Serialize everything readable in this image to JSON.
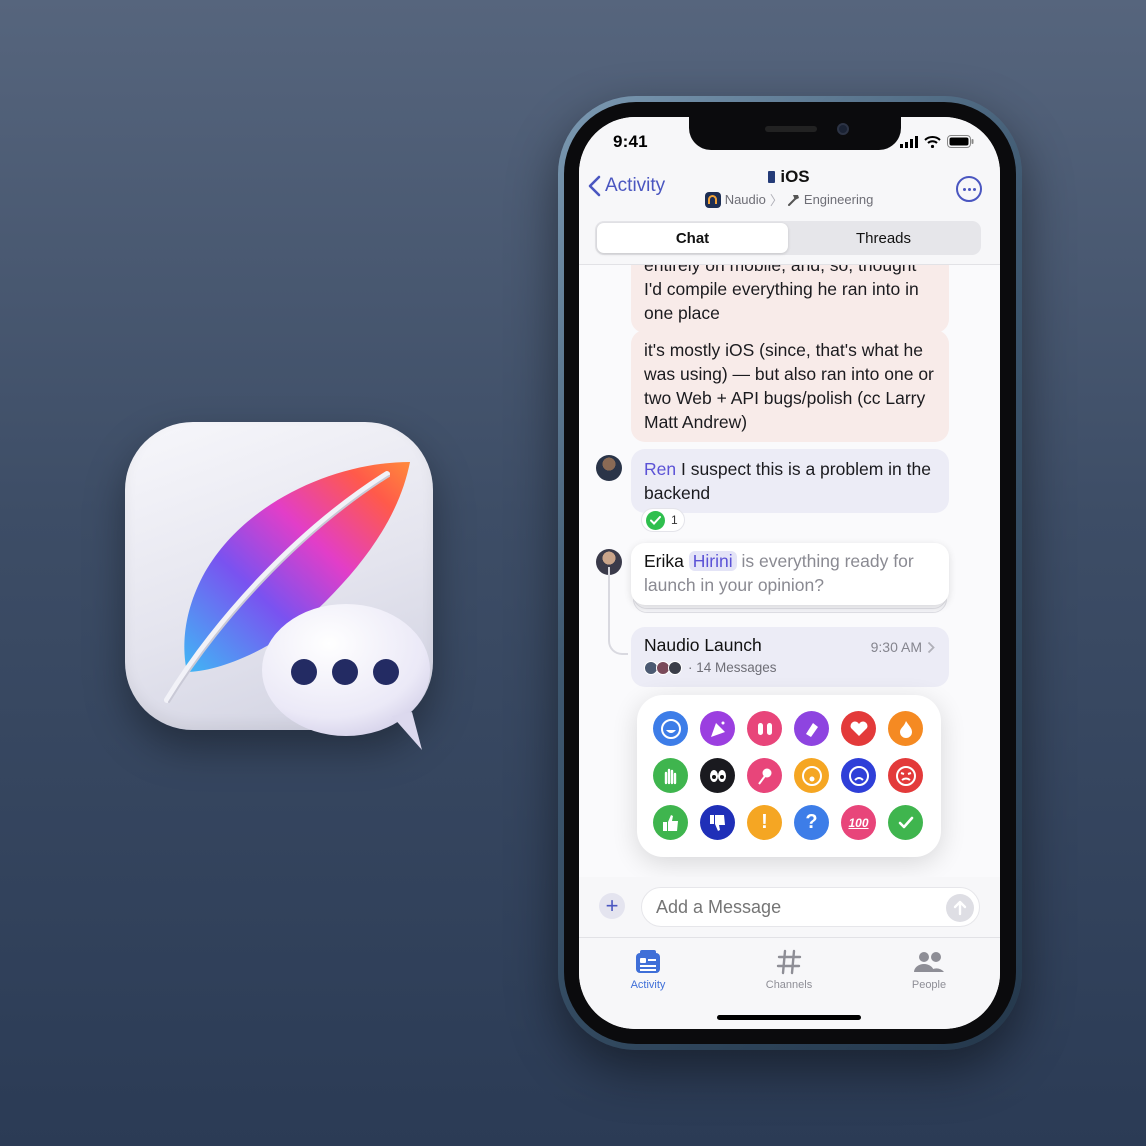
{
  "status_bar": {
    "time": "9:41"
  },
  "nav": {
    "back_label": "Activity",
    "channel_name": "iOS",
    "workspace": "Naudio",
    "section": "Engineering"
  },
  "segments": {
    "chat": "Chat",
    "threads": "Threads",
    "active": "Chat"
  },
  "messages": {
    "m1": "entirely on mobile, and, so, thought I'd compile everything he ran into in one place",
    "m2": "it's mostly iOS (since, that's what he was using) — but also ran into one or two Web + API bugs/polish (cc Larry Matt Andrew)",
    "m3_mention": "Ren",
    "m3_text": " I suspect this is a problem in the backend",
    "m3_reaction_count": "1",
    "m4_author": "Erika",
    "m4_mention": "Hirini",
    "m4_text": " is everything ready for launch in your opinion?"
  },
  "thread": {
    "title": "Naudio Launch",
    "time": "9:30 AM",
    "count": "· 14 Messages"
  },
  "reactions": [
    "laughing-icon",
    "party-popper-icon",
    "raised-hands-icon",
    "clapping-icon",
    "heart-icon",
    "fire-icon",
    "wave-icon",
    "eyes-icon",
    "rose-icon",
    "surprised-icon",
    "sad-icon",
    "angry-icon",
    "thumbs-up-icon",
    "thumbs-down-icon",
    "exclamation-icon",
    "question-icon",
    "hundred-icon",
    "checkmark-icon"
  ],
  "composer": {
    "placeholder": "Add a Message"
  },
  "tabs": {
    "activity": "Activity",
    "channels": "Channels",
    "people": "People",
    "active": "Activity"
  },
  "colors": {
    "accent": "#4a56c0",
    "tab_active": "#3f6fd8",
    "mention": "#5b52d6"
  }
}
